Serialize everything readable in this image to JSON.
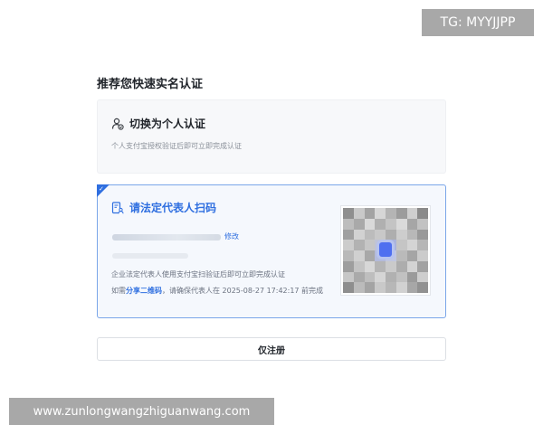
{
  "watermarks": {
    "top_right": "TG: MYYJJPP",
    "bottom_left": "www.zunlongwangzhiguanwang.com"
  },
  "section": {
    "title": "推荐您快速实名认证"
  },
  "personal_card": {
    "title": "切换为个人认证",
    "description": "个人支付宝授权验证后即可立即完成认证",
    "icon": "person-verify-icon"
  },
  "legal_card": {
    "title": "请法定代表人扫码",
    "icon": "document-person-icon",
    "edit_label": "修改",
    "description": "企业法定代表人使用支付宝扫验证后即可立即完成认证",
    "share_prefix": "如需",
    "share_link": "分享二维码",
    "share_suffix": "，请确保代表人在 2025-08-27 17:42:17 前完成"
  },
  "buttons": {
    "register_only": "仅注册"
  },
  "colors": {
    "accent": "#2f6fe0",
    "selected_border": "#7aa6e9",
    "selected_bg": "#f5f8fd",
    "muted_text": "#8a9099"
  }
}
